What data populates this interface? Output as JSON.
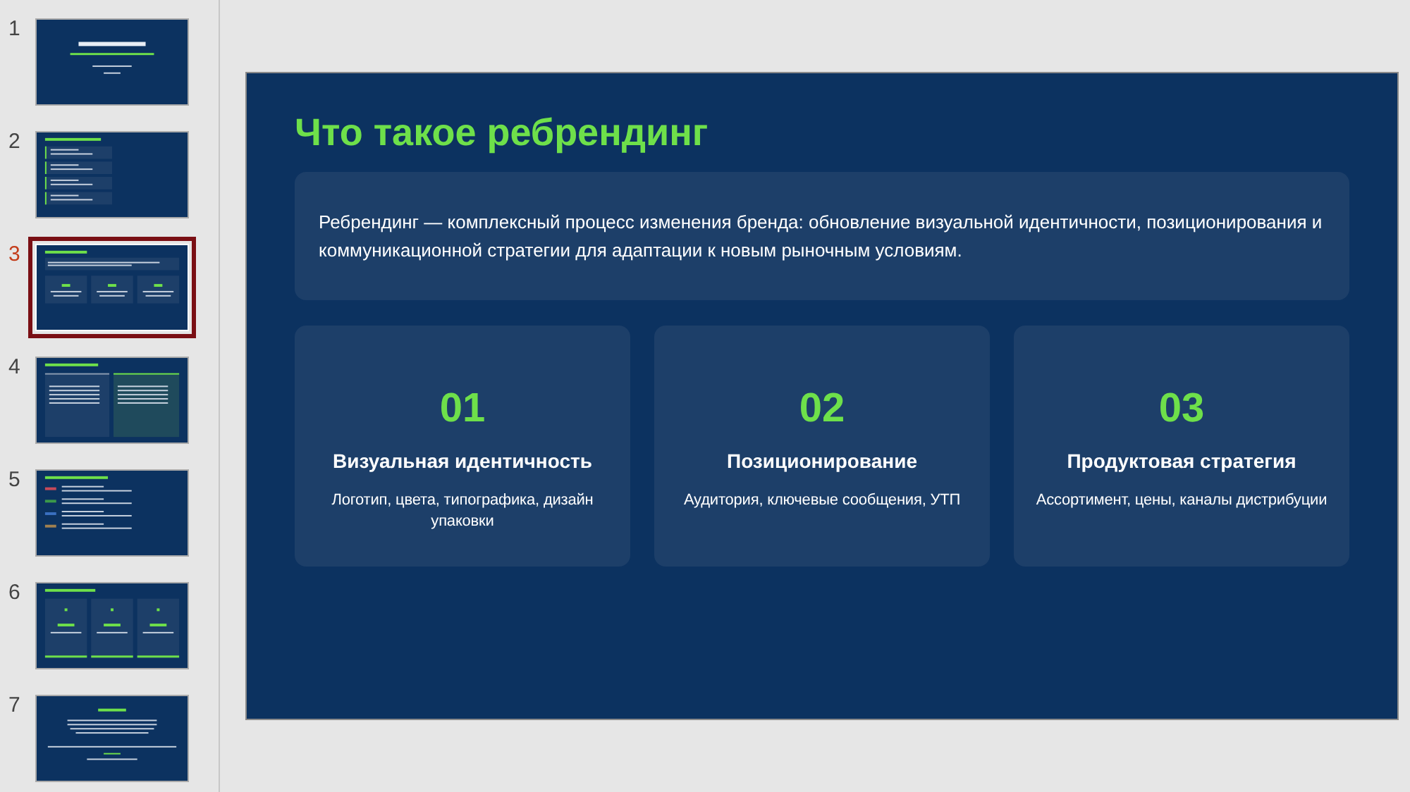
{
  "slides": [
    {
      "number": "1",
      "kind": "title",
      "selected": false
    },
    {
      "number": "2",
      "kind": "list",
      "selected": false
    },
    {
      "number": "3",
      "kind": "cards",
      "selected": true
    },
    {
      "number": "4",
      "kind": "columns",
      "selected": false
    },
    {
      "number": "5",
      "kind": "rows",
      "selected": false
    },
    {
      "number": "6",
      "kind": "stats",
      "selected": false
    },
    {
      "number": "7",
      "kind": "closing",
      "selected": false
    }
  ],
  "current_slide": {
    "title": "Что такое ребрендинг",
    "definition": "Ребрендинг — комплексный процесс изменения бренда: обновление визуальной идентичности, позиционирования и коммуникационной стратегии для адаптации к новым рыночным условиям.",
    "cards": [
      {
        "number": "01",
        "heading": "Визуальная идентичность",
        "text": "Логотип, цвета, типографика, дизайн упаковки"
      },
      {
        "number": "02",
        "heading": "Позиционирование",
        "text": "Аудитория, ключевые сообщения, УТП"
      },
      {
        "number": "03",
        "heading": "Продуктовая стратегия",
        "text": "Ассортимент, цены, каналы дистрибуции"
      }
    ]
  }
}
